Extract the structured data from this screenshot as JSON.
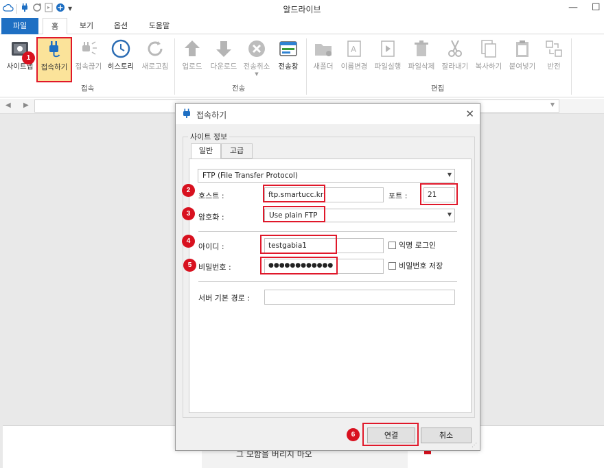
{
  "app": {
    "title": "알드라이브"
  },
  "ribbon": {
    "tabs": [
      {
        "label": "파일"
      },
      {
        "label": "홈"
      },
      {
        "label": "보기"
      },
      {
        "label": "옵션"
      },
      {
        "label": "도움말"
      }
    ],
    "groups": {
      "connect": "접속",
      "transfer": "전송",
      "edit": "편집"
    },
    "buttons": {
      "sitemap": "사이트맵",
      "connect": "접속하기",
      "disconnect": "접속끊기",
      "history": "히스토리",
      "refresh": "새로고침",
      "upload": "업로드",
      "download": "다운로드",
      "cancel_transfer": "전송취소",
      "transfer_window": "전송창",
      "new_folder": "새폴더",
      "rename": "이름변경",
      "run_file": "파일실행",
      "delete_file": "파일삭제",
      "cut": "잘라내기",
      "copy": "복사하기",
      "paste": "붙여넣기",
      "invert": "반전"
    }
  },
  "dialog": {
    "title": "접속하기",
    "section": "사이트 정보",
    "tabs": {
      "general": "일반",
      "advanced": "고급"
    },
    "protocol": "FTP (File Transfer Protocol)",
    "host_label": "호스트 :",
    "host_value": "ftp.smartucc.kr",
    "port_label": "포트 :",
    "port_value": "21",
    "encryption_label": "암호화 :",
    "encryption_value": "Use plain FTP",
    "id_label": "아이디 :",
    "id_value": "testgabia1",
    "anonymous_label": "익명 로그인",
    "password_label": "비밀번호 :",
    "password_value": "●●●●●●●●●●●●",
    "save_password_label": "비밀번호 저장",
    "server_path_label": "서버 기본 경로 :",
    "server_path_value": "",
    "connect_button": "연결",
    "cancel_button": "취소"
  },
  "background": {
    "banner_text": "그 모함을 버리지 마오"
  },
  "annotations": [
    "1",
    "2",
    "3",
    "4",
    "5",
    "6"
  ],
  "colors": {
    "accent": "#1e6fc3",
    "highlight": "#e0182a",
    "selected_button_bg": "#fbe39a"
  }
}
